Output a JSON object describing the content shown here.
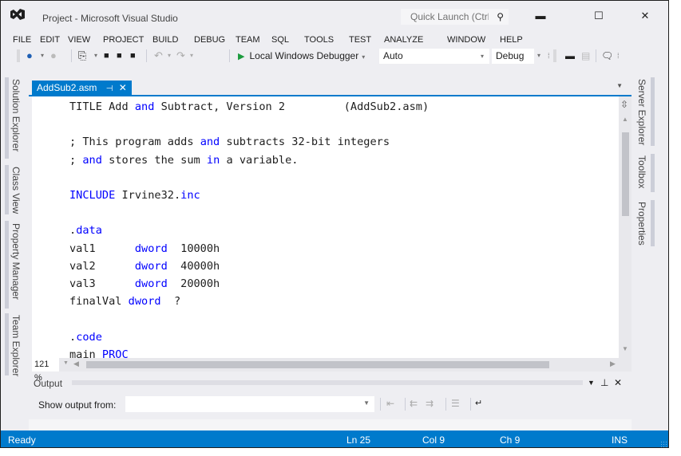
{
  "window": {
    "title": "Project - Microsoft Visual Studio",
    "quick_launch_placeholder": "Quick Launch (Ctrl+Q)",
    "controls": {
      "minimize": "▬",
      "maximize": "☐",
      "close": "✕"
    }
  },
  "menu": [
    "FILE",
    "EDIT",
    "VIEW",
    "PROJECT",
    "BUILD",
    "DEBUG",
    "TEAM",
    "SQL",
    "TOOLS",
    "TEST",
    "ANALYZE",
    "WINDOW",
    "HELP"
  ],
  "toolbar": {
    "icons": {
      "back": "◀",
      "forward": "▶",
      "new_project": "⎘",
      "open": "📂",
      "save": "💾",
      "save_all": "🗂",
      "undo": "↶",
      "redo": "↷",
      "dropdown": "▾"
    },
    "debugger_label": "Local Windows Debugger",
    "platform_value": "Auto",
    "config_value": "Debug"
  },
  "left_tabs": [
    "Solution Explorer",
    "Class View",
    "Property Manager",
    "Team Explorer"
  ],
  "right_tabs": [
    "Server Explorer",
    "Toolbox",
    "Properties"
  ],
  "editor": {
    "tab": {
      "filename": "AddSub2.asm",
      "pin": "⊣",
      "close": "✕"
    },
    "zoom": "121 %",
    "lines": [
      [
        {
          "t": "TITLE Add "
        },
        {
          "t": "and",
          "k": 1
        },
        {
          "t": " Subtract, Version 2         (AddSub2.asm)"
        }
      ],
      [
        {
          "t": ""
        }
      ],
      [
        {
          "t": "; This program adds "
        },
        {
          "t": "and",
          "k": 1
        },
        {
          "t": " subtracts 32-bit integers"
        }
      ],
      [
        {
          "t": "; "
        },
        {
          "t": "and",
          "k": 1
        },
        {
          "t": " stores the sum "
        },
        {
          "t": "in",
          "k": 1
        },
        {
          "t": " a variable."
        }
      ],
      [
        {
          "t": ""
        }
      ],
      [
        {
          "t": "INCLUDE",
          "k": 1
        },
        {
          "t": " Irvine32."
        },
        {
          "t": "inc",
          "k": 1
        }
      ],
      [
        {
          "t": ""
        }
      ],
      [
        {
          "t": "."
        },
        {
          "t": "data",
          "k": 1
        }
      ],
      [
        {
          "t": "val1      "
        },
        {
          "t": "dword",
          "k": 1
        },
        {
          "t": "  10000h"
        }
      ],
      [
        {
          "t": "val2      "
        },
        {
          "t": "dword",
          "k": 1
        },
        {
          "t": "  40000h"
        }
      ],
      [
        {
          "t": "val3      "
        },
        {
          "t": "dword",
          "k": 1
        },
        {
          "t": "  20000h"
        }
      ],
      [
        {
          "t": "finalVal "
        },
        {
          "t": "dword",
          "k": 1
        },
        {
          "t": "  ?"
        }
      ],
      [
        {
          "t": ""
        }
      ],
      [
        {
          "t": "."
        },
        {
          "t": "code",
          "k": 1
        }
      ],
      [
        {
          "t": "main "
        },
        {
          "t": "PROC",
          "k": 1
        }
      ]
    ]
  },
  "output": {
    "title": "Output",
    "show_label": "Show output from:",
    "show_value": ""
  },
  "status": {
    "ready": "Ready",
    "line": "Ln 25",
    "col": "Col 9",
    "ch": "Ch 9",
    "mode": "INS"
  },
  "colors": {
    "accent": "#007acc",
    "keyword": "#0000ff",
    "run": "#1c9b3e"
  }
}
